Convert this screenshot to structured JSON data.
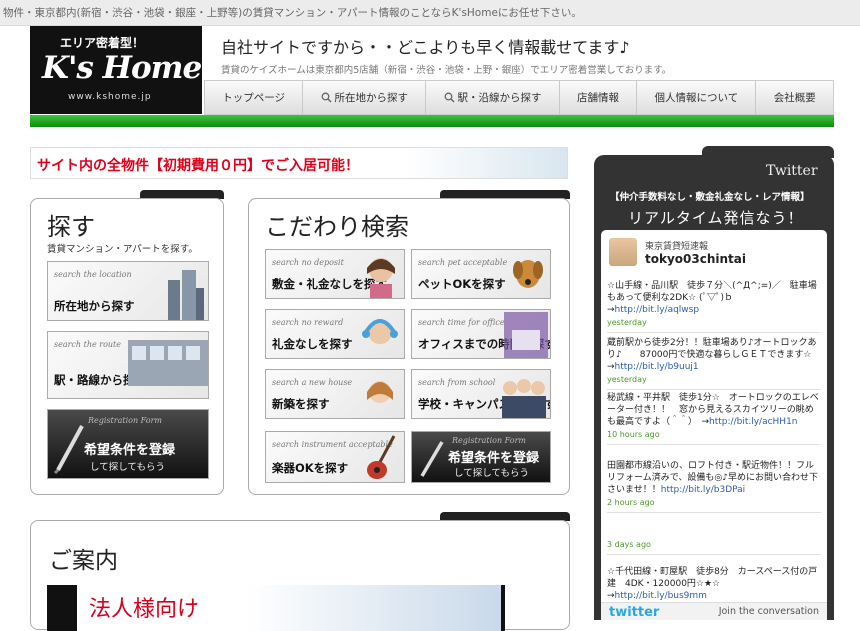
{
  "header": {
    "tagline": "物件・東京都内(新宿・渋谷・池袋・銀座・上野等)の賃貸マンション・アパート情報のことならK'sHomeにお任せ下さい。",
    "logo_top": "エリア密着型！",
    "logo_main": "K's Home",
    "logo_url": "www.kshome.jp",
    "title": "自社サイトですから・・どこよりも早く情報載せてます♪",
    "subtitle": "賃貸のケイズホームは東京都内5店舗（新宿・渋谷・池袋・上野・銀座）でエリア密着営業しております。"
  },
  "nav": [
    {
      "label": "トップページ",
      "icon": ""
    },
    {
      "label": "所在地から探す",
      "icon": "search-icon"
    },
    {
      "label": "駅・沿線から探す",
      "icon": "search-icon"
    },
    {
      "label": "店舗情報",
      "icon": ""
    },
    {
      "label": "個人情報について",
      "icon": ""
    },
    {
      "label": "会社概要",
      "icon": ""
    }
  ],
  "banner": "サイト内の全物件【初期費用０円】でご入居可能！",
  "search_panel": {
    "title": "探す",
    "subtitle": "賃貸マンション・アパートを探す。",
    "tiles": [
      {
        "small": "search the location",
        "big": "所在地から探す"
      },
      {
        "small": "search the route",
        "big": "駅・路線から探す"
      }
    ],
    "registration": {
      "small": "Registration Form",
      "big": "希望条件を登録",
      "small2": "して探してもらう"
    }
  },
  "kodawari_panel": {
    "title": "こだわり検索",
    "tiles": [
      {
        "small": "search no deposit",
        "big": "敷金・礼金なしを探す"
      },
      {
        "small": "search pet acceptable",
        "big": "ペットOKを探す"
      },
      {
        "small": "search no reward",
        "big": "礼金なしを探す"
      },
      {
        "small": "search time for office",
        "big": "オフィスまでの時間で探す"
      },
      {
        "small": "search a new house",
        "big": "新築を探す"
      },
      {
        "small": "search from school",
        "big": "学校・キャンパスから探す"
      },
      {
        "small": "search instrument acceptable",
        "big": "楽器OKを探す"
      }
    ],
    "registration": {
      "small": "Registration Form",
      "big": "希望条件を登録",
      "small2": "して探してもらう"
    }
  },
  "annai": {
    "title": "ご案内",
    "image_text": "法人様向け"
  },
  "twitter": {
    "title": "Twitter",
    "sub1": "【仲介手数料なし・敷金礼金なし・レア情報】",
    "sub2": "リアルタイム発信なう！",
    "account_name": "東京賃貸短速報",
    "handle": "tokyo03chintai",
    "tweets": [
      {
        "text": "☆山手線・品川駅　徒歩７分＼(^Д^;=)／　駐車場もあって便利な2DK☆ (ﾟ▽ﾟ)ｂ→",
        "link": "http://bit.ly/aqlwsp",
        "time": "yesterday"
      },
      {
        "text": "蔵前駅から徒歩2分！！駐車場あり♪オートロックあり♪　　87000円で快適な暮らしＧＥＴできます☆　　　→",
        "link": "http://bit.ly/b9uuj1",
        "time": "yesterday"
      },
      {
        "text": "秘武線・平井駅　徒歩1分☆　オートロックのエレベーター付き！！　窓から見えるスカイツリーの眺めも最高ですよ（＾＾）　→",
        "link": "http://bit.ly/acHH1n",
        "time": "10 hours ago"
      },
      {
        "text": "田園都市線沿いの、ロフト付き・駅近物件！！フルリフォーム済みで、設備も◎♪早めにお問い合わせ下さいませ！！",
        "link": "http://bit.ly/b3DPai",
        "time": "2 hours ago"
      },
      {
        "text": "",
        "link": "",
        "time": "3 days ago"
      },
      {
        "text": "☆千代田線・町屋駅　徒歩8分　カースペース付の戸建　4DK・120000円☆★☆ →",
        "link": "http://bit.ly/bus9mm",
        "time": ""
      }
    ],
    "footer_logo": "twitter",
    "footer_join": "Join the conversation"
  }
}
